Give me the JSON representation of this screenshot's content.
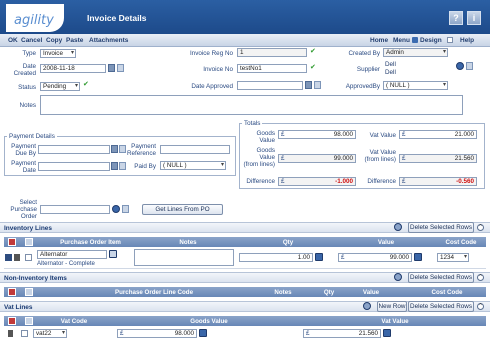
{
  "header": {
    "logo": "agility",
    "title": "Invoice Details",
    "help_label": "?",
    "info_label": "i"
  },
  "toolbar": {
    "ok": "OK",
    "cancel": "Cancel",
    "copy": "Copy",
    "paste": "Paste",
    "attachments": "Attachments",
    "home": "Home",
    "menu": "Menu",
    "design": "Design",
    "help": "Help"
  },
  "form": {
    "type_label": "Type",
    "type_value": "Invoice",
    "date_created_label": "Date Created",
    "date_created_value": "2008-11-18",
    "status_label": "Status",
    "status_value": "Pending",
    "notes_label": "Notes",
    "notes_value": "",
    "invoice_reg_label": "Invoice Reg No",
    "invoice_reg_value": "1",
    "invoice_no_label": "Invoice No",
    "invoice_no_value": "testNo1",
    "date_approved_label": "Date Approved",
    "date_approved_value": "",
    "created_by_label": "Created By",
    "created_by_value": "Admin",
    "supplier_label": "Supplier",
    "supplier_value": "Dell",
    "supplier_sub": "Dell",
    "approved_by_label": "ApprovedBy",
    "approved_by_value": "( NULL )"
  },
  "payment": {
    "title": "Payment Details",
    "due_label": "Payment Due By",
    "due_value": "",
    "date_label": "Payment Date",
    "date_value": "",
    "ref_label": "Payment Reference",
    "ref_value": "",
    "paid_by_label": "Paid By",
    "paid_by_value": "( NULL )"
  },
  "totals": {
    "title": "Totals",
    "goods_label": "Goods Value",
    "goods_value": "98.000",
    "vat_label": "Vat Value",
    "vat_value": "21.000",
    "goods_lines_label": "Goods Value (from lines)",
    "goods_lines_value": "99.000",
    "vat_lines_label": "Vat Value (from lines)",
    "vat_lines_value": "21.560",
    "diff_label": "Difference",
    "diff_value": "-1.000",
    "vat_diff_label": "Difference",
    "vat_diff_value": "-0.560",
    "currency": "£"
  },
  "po": {
    "label": "Select Purchase Order",
    "value": "",
    "button": "Get Lines From PO"
  },
  "inventory": {
    "title": "Inventory Lines",
    "delete_button": "Delete Selected Rows",
    "columns": [
      "Purchase Order Item",
      "Notes",
      "Qty",
      "Value",
      "Cost Code"
    ],
    "row": {
      "item": "Alternator",
      "item_sub": "Alternator - Complete",
      "notes": "",
      "qty": "1.00",
      "value": "99.000",
      "cost_code": "1234"
    }
  },
  "non_inventory": {
    "title": "Non-Inventory Items",
    "delete_button": "Delete Selected Rows",
    "columns": [
      "Purchase Order Line Code",
      "Notes",
      "Qty",
      "Value",
      "Cost Code"
    ]
  },
  "vat": {
    "title": "Vat Lines",
    "new_button": "New Row",
    "delete_button": "Delete Selected Rows",
    "columns": [
      "Vat Code",
      "Goods Value",
      "Vat Value"
    ],
    "row": {
      "code": "vat22",
      "goods": "98.000",
      "vat": "21.560"
    }
  }
}
